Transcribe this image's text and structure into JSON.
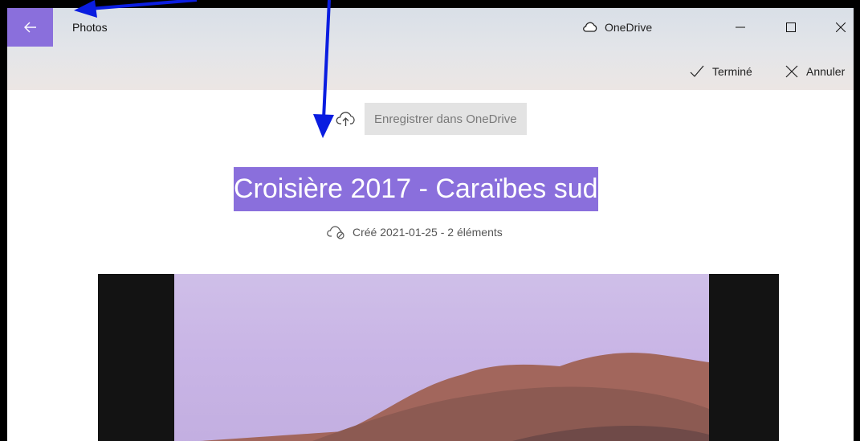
{
  "titlebar": {
    "back_icon": "arrow-left-icon",
    "app_name": "Photos",
    "onedrive_label": "OneDrive",
    "onedrive_icon": "cloud-icon",
    "minimize_icon": "minimize-icon",
    "maximize_icon": "maximize-icon",
    "close_icon": "close-icon"
  },
  "commandbar": {
    "done_label": "Terminé",
    "done_icon": "checkmark-icon",
    "cancel_label": "Annuler",
    "cancel_icon": "close-icon"
  },
  "album": {
    "save_icon": "cloud-upload-icon",
    "save_label": "Enregistrer dans OneDrive",
    "title": "Croisière 2017 - Caraïbes sud",
    "meta_icon": "cloud-off-icon",
    "meta": "Créé 2021-01-25  -  2 éléments"
  },
  "colors": {
    "accent": "#8a6fdc",
    "annotation_arrow": "#0a1de0"
  }
}
